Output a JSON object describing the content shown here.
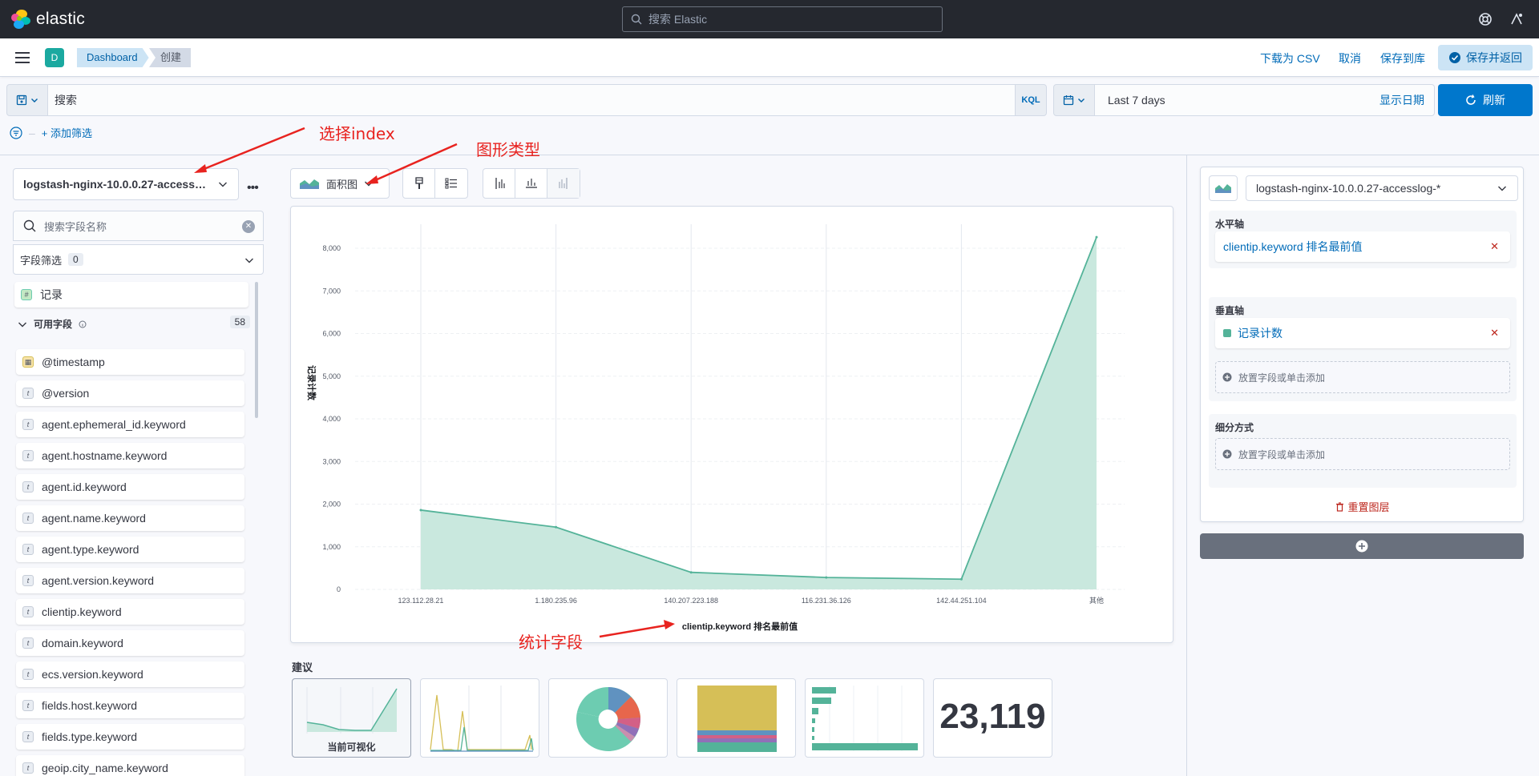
{
  "header": {
    "logo_text": "elastic",
    "search_placeholder": "搜索 Elastic"
  },
  "subheader": {
    "space_initial": "D",
    "breadcrumbs": [
      "Dashboard",
      "创建"
    ],
    "download_csv": "下载为 CSV",
    "cancel": "取消",
    "save_to_library": "保存到库",
    "save_and_return": "保存并返回"
  },
  "query": {
    "placeholder": "搜索",
    "language": "KQL",
    "date_range": "Last 7 days",
    "show_dates": "显示日期",
    "refresh": "刷新",
    "add_filter": "+ 添加筛选"
  },
  "left_panel": {
    "index_pattern": "logstash-nginx-10.0.0.27-accesslog-*",
    "field_search_placeholder": "搜索字段名称",
    "field_filter_label": "字段筛选",
    "field_filter_count": "0",
    "records_field": "记录",
    "available_fields_label": "可用字段",
    "available_fields_count": "58",
    "fields": [
      {
        "name": "@timestamp",
        "type": "date"
      },
      {
        "name": "@version",
        "type": "t"
      },
      {
        "name": "agent.ephemeral_id.keyword",
        "type": "t"
      },
      {
        "name": "agent.hostname.keyword",
        "type": "t"
      },
      {
        "name": "agent.id.keyword",
        "type": "t"
      },
      {
        "name": "agent.name.keyword",
        "type": "t"
      },
      {
        "name": "agent.type.keyword",
        "type": "t"
      },
      {
        "name": "agent.version.keyword",
        "type": "t"
      },
      {
        "name": "clientip.keyword",
        "type": "t"
      },
      {
        "name": "domain.keyword",
        "type": "t"
      },
      {
        "name": "ecs.version.keyword",
        "type": "t"
      },
      {
        "name": "fields.host.keyword",
        "type": "t"
      },
      {
        "name": "fields.type.keyword",
        "type": "t"
      },
      {
        "name": "geoip.city_name.keyword",
        "type": "t"
      }
    ]
  },
  "toolbar": {
    "chart_type": "面积图"
  },
  "chart_data": {
    "type": "area",
    "categories": [
      "123.112.28.21",
      "1.180.235.96",
      "140.207.223.188",
      "116.231.36.126",
      "142.44.251.104",
      "其他"
    ],
    "values": [
      1860,
      1460,
      400,
      280,
      240,
      8260
    ],
    "ylabel": "记录计数",
    "xlabel": "clientip.keyword 排名最前值",
    "ylim": [
      0,
      8000
    ],
    "yticks": [
      0,
      1000,
      2000,
      3000,
      4000,
      5000,
      6000,
      7000,
      8000
    ],
    "ytick_labels": [
      "0",
      "1,000",
      "2,000",
      "3,000",
      "4,000",
      "5,000",
      "6,000",
      "7,000",
      "8,000"
    ],
    "grid": true,
    "color": "#54b399"
  },
  "suggestions": {
    "label": "建议",
    "current_label": "当前可视化",
    "metric_value": "23,119"
  },
  "right_panel": {
    "layer_index": "logstash-nginx-10.0.0.27-accesslog-*",
    "horizontal_axis_label": "水平轴",
    "horizontal_axis_field": "clientip.keyword 排名最前值",
    "vertical_axis_label": "垂直轴",
    "vertical_axis_field": "记录计数",
    "drop_hint": "放置字段或单击添加",
    "breakdown_label": "细分方式",
    "reset_layer": "重置图层"
  },
  "annotations": {
    "select_index": "选择index",
    "chart_type": "图形类型",
    "stat_field": "统计字段"
  },
  "colors": {
    "accent": "#0077cc",
    "area": "#54b399",
    "annotation": "#e8231f"
  }
}
